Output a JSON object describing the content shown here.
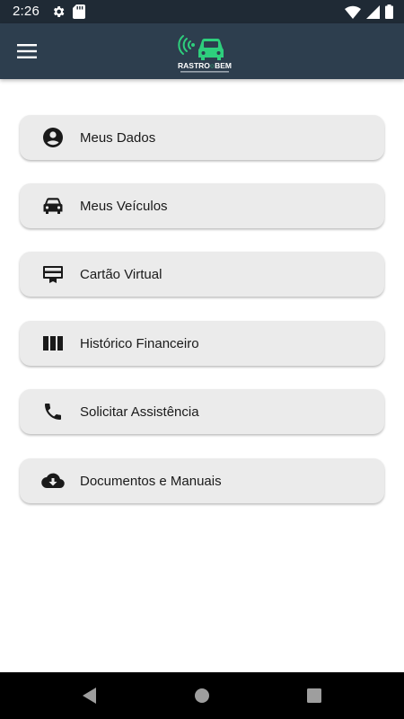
{
  "status_bar": {
    "time": "2:26",
    "icons": [
      "settings-icon",
      "sd-card-icon",
      "wifi-icon",
      "signal-icon",
      "battery-icon"
    ]
  },
  "app_bar": {
    "menu_icon": "hamburger-menu-icon",
    "logo": {
      "brand": "RASTRO BEM",
      "tagline": "SOLUÇÕES EM RASTREAMENTO VEICULAR",
      "color": "#2ecf7d"
    }
  },
  "menu": {
    "items": [
      {
        "label": "Meus Dados",
        "icon": "account-circle-icon"
      },
      {
        "label": "Meus Veículos",
        "icon": "car-icon"
      },
      {
        "label": "Cartão Virtual",
        "icon": "card-membership-icon"
      },
      {
        "label": "Histórico Financeiro",
        "icon": "view-column-icon"
      },
      {
        "label": "Solicitar Assistência",
        "icon": "phone-icon"
      },
      {
        "label": "Documentos e Manuais",
        "icon": "cloud-download-icon"
      }
    ]
  },
  "nav_bar": {
    "buttons": [
      "back-icon",
      "home-icon",
      "recents-icon"
    ]
  },
  "colors": {
    "app_bar": "#2d3e4e",
    "status_bar": "#1f2a35",
    "item_bg": "#ebebeb",
    "logo_accent": "#2ecf7d"
  }
}
